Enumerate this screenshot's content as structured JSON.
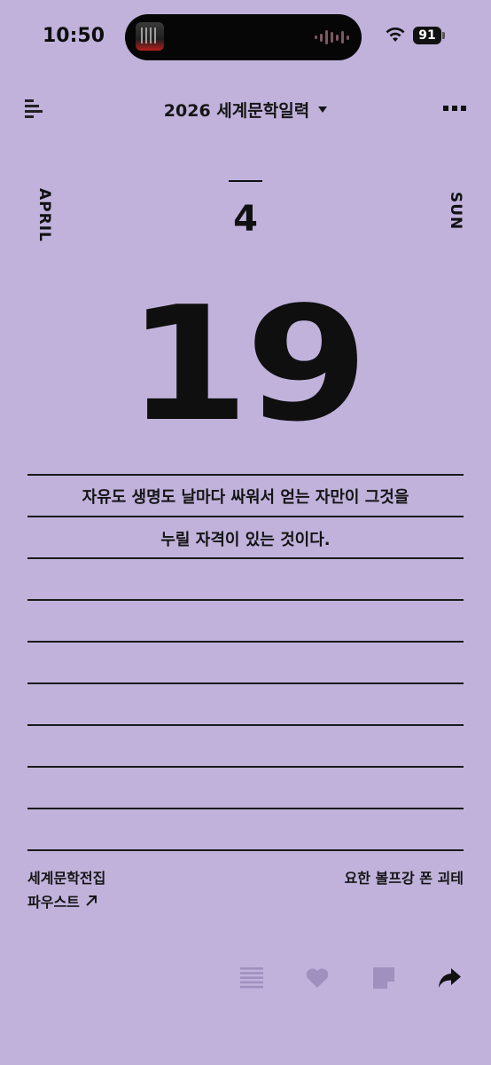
{
  "status_bar": {
    "time": "10:50",
    "battery": "91",
    "icons": [
      "now-playing-artwork",
      "audio-waveform-icon",
      "wifi-icon",
      "battery-icon"
    ]
  },
  "header": {
    "title": "2026 세계문학일력",
    "icons": [
      "menu-icon",
      "chevron-down-icon",
      "more-icon"
    ]
  },
  "calendar": {
    "month_name": "APRIL",
    "month_number": "4",
    "day": "19",
    "weekday": "SUN"
  },
  "quote": {
    "line1": "자유도 생명도 날마다 싸워서 얻는 자만이 그것을",
    "line2": "누릴 자격이 있는 것이다."
  },
  "source": {
    "book": "세계문학전집",
    "work": "파우스트",
    "author": "요한 볼프강 폰 괴테",
    "link_icon": "arrow-up-right-icon"
  },
  "toolbar": {
    "icons": [
      "list-icon",
      "heart-icon",
      "note-icon",
      "share-icon"
    ]
  },
  "colors": {
    "background": "#c1b2dc",
    "text": "#111111",
    "inactive_icon": "#9f90bd"
  }
}
